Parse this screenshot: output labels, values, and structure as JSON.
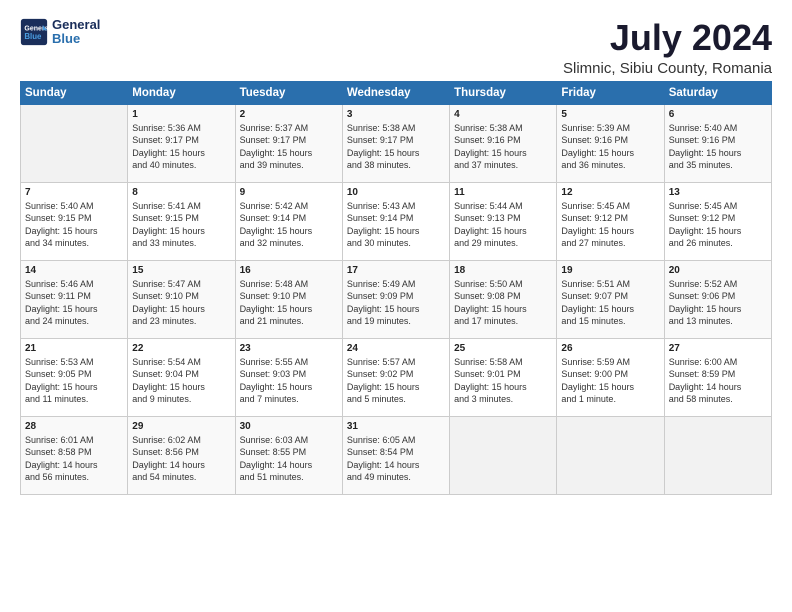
{
  "header": {
    "logo_line1": "General",
    "logo_line2": "Blue",
    "title": "July 2024",
    "subtitle": "Slimnic, Sibiu County, Romania"
  },
  "weekdays": [
    "Sunday",
    "Monday",
    "Tuesday",
    "Wednesday",
    "Thursday",
    "Friday",
    "Saturday"
  ],
  "weeks": [
    [
      {
        "day": "",
        "text": ""
      },
      {
        "day": "1",
        "text": "Sunrise: 5:36 AM\nSunset: 9:17 PM\nDaylight: 15 hours\nand 40 minutes."
      },
      {
        "day": "2",
        "text": "Sunrise: 5:37 AM\nSunset: 9:17 PM\nDaylight: 15 hours\nand 39 minutes."
      },
      {
        "day": "3",
        "text": "Sunrise: 5:38 AM\nSunset: 9:17 PM\nDaylight: 15 hours\nand 38 minutes."
      },
      {
        "day": "4",
        "text": "Sunrise: 5:38 AM\nSunset: 9:16 PM\nDaylight: 15 hours\nand 37 minutes."
      },
      {
        "day": "5",
        "text": "Sunrise: 5:39 AM\nSunset: 9:16 PM\nDaylight: 15 hours\nand 36 minutes."
      },
      {
        "day": "6",
        "text": "Sunrise: 5:40 AM\nSunset: 9:16 PM\nDaylight: 15 hours\nand 35 minutes."
      }
    ],
    [
      {
        "day": "7",
        "text": "Sunrise: 5:40 AM\nSunset: 9:15 PM\nDaylight: 15 hours\nand 34 minutes."
      },
      {
        "day": "8",
        "text": "Sunrise: 5:41 AM\nSunset: 9:15 PM\nDaylight: 15 hours\nand 33 minutes."
      },
      {
        "day": "9",
        "text": "Sunrise: 5:42 AM\nSunset: 9:14 PM\nDaylight: 15 hours\nand 32 minutes."
      },
      {
        "day": "10",
        "text": "Sunrise: 5:43 AM\nSunset: 9:14 PM\nDaylight: 15 hours\nand 30 minutes."
      },
      {
        "day": "11",
        "text": "Sunrise: 5:44 AM\nSunset: 9:13 PM\nDaylight: 15 hours\nand 29 minutes."
      },
      {
        "day": "12",
        "text": "Sunrise: 5:45 AM\nSunset: 9:12 PM\nDaylight: 15 hours\nand 27 minutes."
      },
      {
        "day": "13",
        "text": "Sunrise: 5:45 AM\nSunset: 9:12 PM\nDaylight: 15 hours\nand 26 minutes."
      }
    ],
    [
      {
        "day": "14",
        "text": "Sunrise: 5:46 AM\nSunset: 9:11 PM\nDaylight: 15 hours\nand 24 minutes."
      },
      {
        "day": "15",
        "text": "Sunrise: 5:47 AM\nSunset: 9:10 PM\nDaylight: 15 hours\nand 23 minutes."
      },
      {
        "day": "16",
        "text": "Sunrise: 5:48 AM\nSunset: 9:10 PM\nDaylight: 15 hours\nand 21 minutes."
      },
      {
        "day": "17",
        "text": "Sunrise: 5:49 AM\nSunset: 9:09 PM\nDaylight: 15 hours\nand 19 minutes."
      },
      {
        "day": "18",
        "text": "Sunrise: 5:50 AM\nSunset: 9:08 PM\nDaylight: 15 hours\nand 17 minutes."
      },
      {
        "day": "19",
        "text": "Sunrise: 5:51 AM\nSunset: 9:07 PM\nDaylight: 15 hours\nand 15 minutes."
      },
      {
        "day": "20",
        "text": "Sunrise: 5:52 AM\nSunset: 9:06 PM\nDaylight: 15 hours\nand 13 minutes."
      }
    ],
    [
      {
        "day": "21",
        "text": "Sunrise: 5:53 AM\nSunset: 9:05 PM\nDaylight: 15 hours\nand 11 minutes."
      },
      {
        "day": "22",
        "text": "Sunrise: 5:54 AM\nSunset: 9:04 PM\nDaylight: 15 hours\nand 9 minutes."
      },
      {
        "day": "23",
        "text": "Sunrise: 5:55 AM\nSunset: 9:03 PM\nDaylight: 15 hours\nand 7 minutes."
      },
      {
        "day": "24",
        "text": "Sunrise: 5:57 AM\nSunset: 9:02 PM\nDaylight: 15 hours\nand 5 minutes."
      },
      {
        "day": "25",
        "text": "Sunrise: 5:58 AM\nSunset: 9:01 PM\nDaylight: 15 hours\nand 3 minutes."
      },
      {
        "day": "26",
        "text": "Sunrise: 5:59 AM\nSunset: 9:00 PM\nDaylight: 15 hours\nand 1 minute."
      },
      {
        "day": "27",
        "text": "Sunrise: 6:00 AM\nSunset: 8:59 PM\nDaylight: 14 hours\nand 58 minutes."
      }
    ],
    [
      {
        "day": "28",
        "text": "Sunrise: 6:01 AM\nSunset: 8:58 PM\nDaylight: 14 hours\nand 56 minutes."
      },
      {
        "day": "29",
        "text": "Sunrise: 6:02 AM\nSunset: 8:56 PM\nDaylight: 14 hours\nand 54 minutes."
      },
      {
        "day": "30",
        "text": "Sunrise: 6:03 AM\nSunset: 8:55 PM\nDaylight: 14 hours\nand 51 minutes."
      },
      {
        "day": "31",
        "text": "Sunrise: 6:05 AM\nSunset: 8:54 PM\nDaylight: 14 hours\nand 49 minutes."
      },
      {
        "day": "",
        "text": ""
      },
      {
        "day": "",
        "text": ""
      },
      {
        "day": "",
        "text": ""
      }
    ]
  ]
}
